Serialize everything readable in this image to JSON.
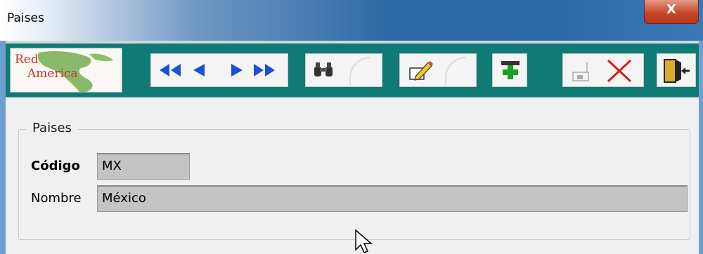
{
  "window": {
    "title": "Paises",
    "close_label": "X"
  },
  "toolbar": {
    "logo": {
      "line1": "Red",
      "line2": "America"
    },
    "nav_icons": [
      "first-record-icon",
      "previous-record-icon",
      "next-record-icon",
      "last-record-icon"
    ],
    "search_icon": "binoculars-icon",
    "edit_icon": "pencil-icon",
    "add_icon": "add-record-icon",
    "save_icon": "save-icon",
    "delete_icon": "delete-icon",
    "exit_icon": "exit-door-icon"
  },
  "form": {
    "group_title": "Paises",
    "codigo_label": "Código",
    "codigo_value": "MX",
    "nombre_label": "Nombre",
    "nombre_value": "México"
  },
  "colors": {
    "toolbar_bg": "#0f7b74",
    "nav_arrow": "#1a4fd6",
    "delete_red": "#d81b1b",
    "add_green": "#19a11f"
  }
}
